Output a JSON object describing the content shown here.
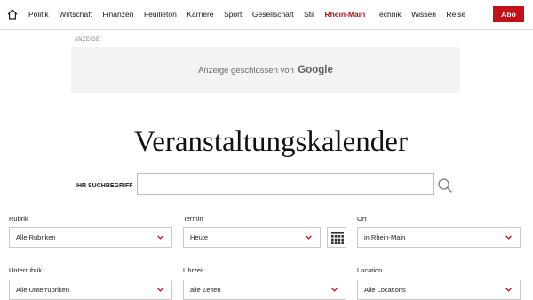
{
  "nav": {
    "home_icon": "home-icon",
    "items": [
      {
        "label": "Politik"
      },
      {
        "label": "Wirtschaft"
      },
      {
        "label": "Finanzen"
      },
      {
        "label": "Feuilleton"
      },
      {
        "label": "Karriere"
      },
      {
        "label": "Sport"
      },
      {
        "label": "Gesellschaft"
      },
      {
        "label": "Stil"
      },
      {
        "label": "Rhein-Main",
        "active": true
      },
      {
        "label": "Technik"
      },
      {
        "label": "Wissen"
      },
      {
        "label": "Reise"
      }
    ],
    "abo_label": "Abo"
  },
  "ad": {
    "label": "ANZEIGE",
    "closed_text": "Anzeige geschlossen von",
    "closed_brand": "Google"
  },
  "page_title": "Veranstaltungskalender",
  "search": {
    "label": "IHR SUCHBEGRIFF",
    "icon": "search-icon"
  },
  "filters": {
    "rubrik": {
      "label": "Rubrik",
      "value": "Alle Rubriken"
    },
    "termin": {
      "label": "Termin",
      "value": "Heute",
      "calendar_icon": "calendar-icon"
    },
    "ort": {
      "label": "Ort",
      "value": "in Rhein-Main"
    },
    "unterrubrik": {
      "label": "Unterrubrik",
      "value": "Alle Unterrubriken"
    },
    "uhrzeit": {
      "label": "Uhrzeit",
      "value": "alle Zeiten"
    },
    "location": {
      "label": "Location",
      "value": "Alle Locations"
    },
    "dropdown_icon": "chevron-down-icon"
  },
  "colors": {
    "accent": "#c41018",
    "active_nav": "#b1121c",
    "ad_background": "#f3f3f3"
  }
}
